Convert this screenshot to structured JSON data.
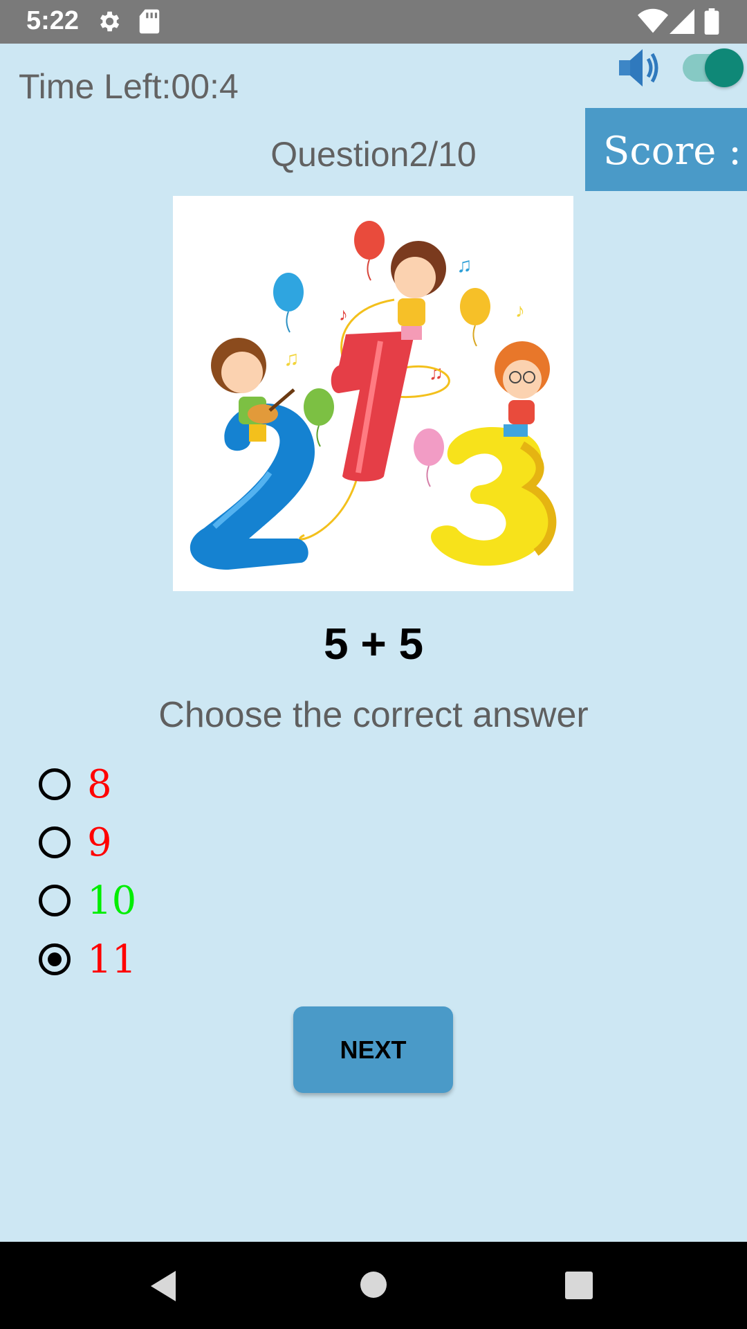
{
  "status_bar": {
    "time": "5:22",
    "icons": [
      "settings-icon",
      "sd-card-icon",
      "wifi-icon",
      "signal-icon",
      "battery-icon"
    ]
  },
  "header": {
    "timer_text": "Time Left:00:4",
    "sound_icon": "speaker-volume-icon",
    "sound_toggle_on": true,
    "score_label": "Score :",
    "question_counter": "Question2/10"
  },
  "illustration": {
    "icon": "kids-numbers-123-illustration"
  },
  "quiz": {
    "equation": "5 + 5",
    "instruction": "Choose the correct answer",
    "options": [
      {
        "label": "8",
        "color": "#ff0000",
        "selected": false
      },
      {
        "label": "9",
        "color": "#ff0000",
        "selected": false
      },
      {
        "label": "10",
        "color": "#00ee00",
        "selected": false
      },
      {
        "label": "11",
        "color": "#ff0000",
        "selected": true
      }
    ],
    "next_label": "NEXT"
  },
  "colors": {
    "background": "#cde7f3",
    "accent": "#4a9ac8",
    "toggle_knob": "#0f8877",
    "correct": "#00ee00",
    "wrong": "#ff0000"
  },
  "nav_bar": {
    "icons": [
      "back-icon",
      "home-icon",
      "recents-icon"
    ]
  }
}
